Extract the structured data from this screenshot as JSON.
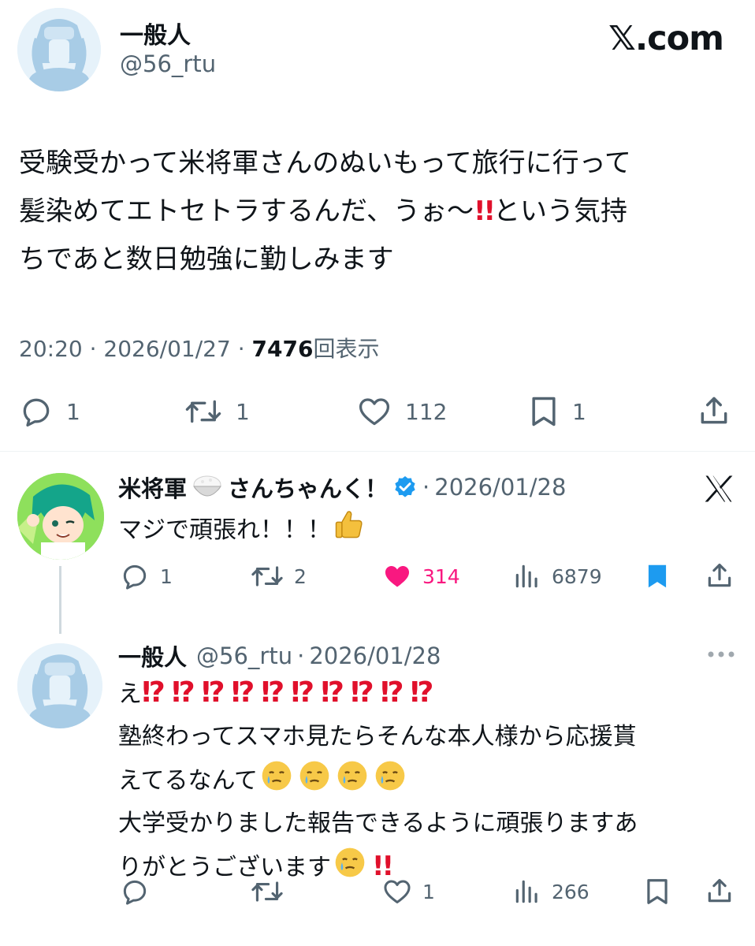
{
  "main_tweet": {
    "author_name": "一般人",
    "author_handle": "@56_rtu",
    "brand": "𝕏.com",
    "text_lines": [
      "受験受かって米将軍さんのぬいもって旅行に行って",
      "髪染めてエトセトラするんだ、うぉ〜",
      "という気持",
      "ちであと数日勉強に勤しみます"
    ],
    "bang": "!!",
    "time": "20:20",
    "date": "2026/01/27",
    "sep": "·",
    "views": "7476",
    "views_label": "回表示",
    "replies": "1",
    "reposts": "1",
    "likes": "112",
    "bookmarks": "1"
  },
  "reply1": {
    "author_name_a": "米将軍",
    "author_name_b": "さんちゃんく！",
    "date": "2026/01/28",
    "text": "マジで頑張れ！！！",
    "replies": "1",
    "reposts": "2",
    "likes": "314",
    "views": "6879",
    "like_color": "#f91880",
    "bookmark_color": "#1d9bf0",
    "verified_color": "#1d9bf0"
  },
  "reply2": {
    "author_name": "一般人",
    "author_handle": "@56_rtu",
    "date": "2026/01/28",
    "line1_prefix": "え",
    "interrobang": "⁉",
    "line2": "塾終わってスマホ見たらそんな本人様から応援貰",
    "line3": "えてるなんて",
    "line4": "大学受かりました報告できるように頑張りますあ",
    "line5": "りがとうございます",
    "bang": "!!",
    "likes": "1",
    "views": "266"
  },
  "icons": [
    "reply-icon",
    "repost-icon",
    "like-icon",
    "bookmark-icon",
    "share-icon",
    "views-icon",
    "verified-icon",
    "more-icon",
    "x-logo-icon",
    "thumbs-up-icon",
    "crying-face-icon",
    "rice-bowl-icon"
  ]
}
